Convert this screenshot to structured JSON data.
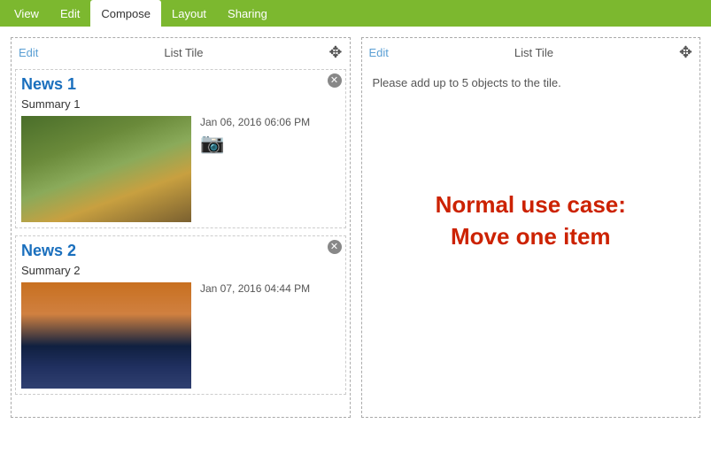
{
  "nav": {
    "items": [
      {
        "label": "View",
        "active": false
      },
      {
        "label": "Edit",
        "active": false
      },
      {
        "label": "Compose",
        "active": true
      },
      {
        "label": "Layout",
        "active": false
      },
      {
        "label": "Sharing",
        "active": false
      }
    ]
  },
  "left_panel": {
    "edit_label": "Edit",
    "tile_label": "List Tile",
    "news_items": [
      {
        "title": "News 1",
        "summary": "Summary 1",
        "date": "Jan 06, 2016 06:06 PM",
        "image_type": "squirrels"
      },
      {
        "title": "News 2",
        "summary": "Summary 2",
        "date": "Jan 07, 2016 04:44 PM",
        "image_type": "sailboat"
      }
    ]
  },
  "right_panel": {
    "edit_label": "Edit",
    "tile_label": "List Tile",
    "add_objects_text": "Please add up to 5 objects to the tile.",
    "normal_use_case_line1": "Normal use case:",
    "normal_use_case_line2": "Move one item"
  }
}
